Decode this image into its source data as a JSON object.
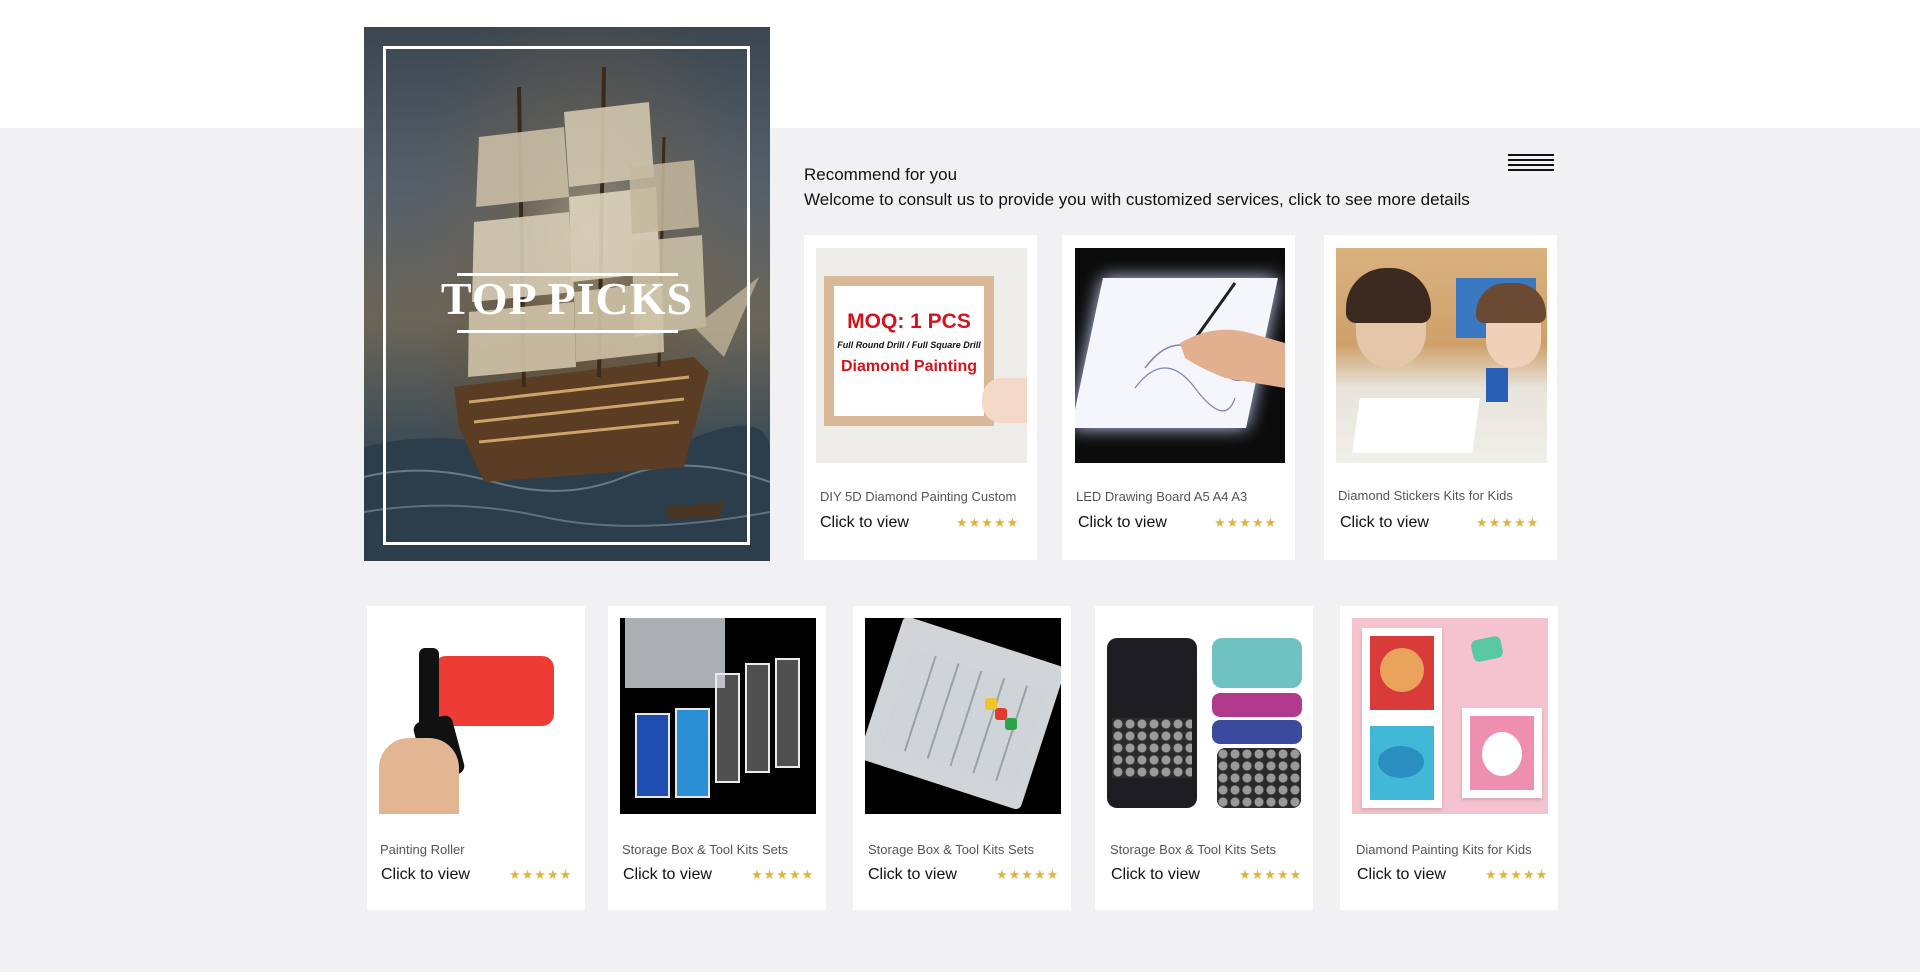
{
  "hero": {
    "title": "TOP PICKS"
  },
  "section": {
    "title": "Recommend for you",
    "subtitle": "Welcome to consult us to provide you with customized services, click to see more details"
  },
  "top_products": [
    {
      "name": "DIY 5D Diamond Painting Custom",
      "cta": "Click to view",
      "stars": "★★★★★",
      "image_text": {
        "line1": "MOQ: 1 PCS",
        "line2": "Full Round Drill / Full Square Drill",
        "line3": "Diamond Painting"
      }
    },
    {
      "name": "LED Drawing Board A5 A4 A3",
      "cta": "Click to view",
      "stars": "★★★★★"
    },
    {
      "name": "Diamond Stickers Kits for Kids",
      "cta": "Click to view",
      "stars": "★★★★★"
    }
  ],
  "bottom_products": [
    {
      "name": "Painting Roller",
      "cta": "Click to view",
      "stars": "★★★★★"
    },
    {
      "name": "Storage Box & Tool Kits Sets",
      "cta": "Click to view",
      "stars": "★★★★★"
    },
    {
      "name": "Storage Box & Tool Kits Sets",
      "cta": "Click to view",
      "stars": "★★★★★"
    },
    {
      "name": "Storage Box & Tool Kits Sets",
      "cta": "Click to view",
      "stars": "★★★★★"
    },
    {
      "name": "Diamond Painting Kits for Kids",
      "cta": "Click to view",
      "stars": "★★★★★"
    }
  ],
  "colors": {
    "band": "#f1f1f3",
    "star": "#e0b341",
    "accent_red": "#d4141c"
  }
}
